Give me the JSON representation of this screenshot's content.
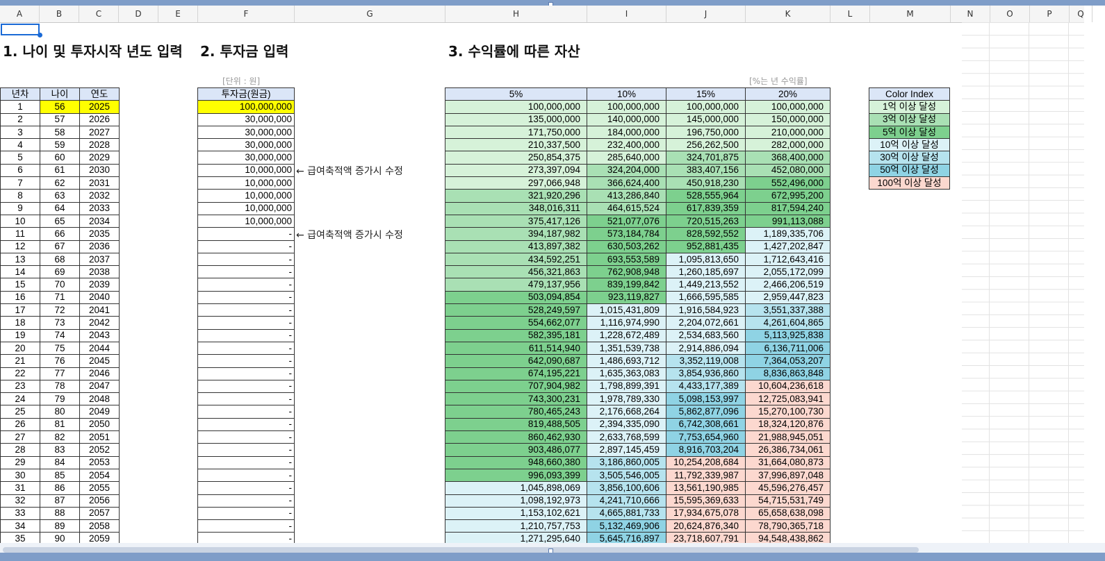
{
  "columns": [
    "A",
    "B",
    "C",
    "D",
    "E",
    "F",
    "G",
    "H",
    "I",
    "J",
    "K",
    "L",
    "M",
    "N",
    "O",
    "P",
    "Q"
  ],
  "titles": {
    "t1": "1. 나이 및 투자시작 년도 입력",
    "t2": "2. 투자금 입력",
    "t3": "3. 수익률에 따른 자산"
  },
  "notes": {
    "unit": "[단위 : 원]",
    "rate": "[%는 년 수익률]"
  },
  "table_a": {
    "headers": [
      "년차",
      "나이",
      "연도"
    ]
  },
  "table_f": {
    "header": "투자금(원금)"
  },
  "table_h": {
    "headers": [
      "5%",
      "10%",
      "15%",
      "20%"
    ]
  },
  "arrows": [
    "← 급여축적액 증가시 수정",
    "← 급여축적액 증가시 수정"
  ],
  "color_index": {
    "header": "Color Index",
    "items": [
      "1억 이상 달성",
      "3억 이상 달성",
      "5억 이상 달성",
      "10억 이상 달성",
      "30억 이상 달성",
      "50억 이상 달성",
      "100억 이상 달성"
    ],
    "colors": [
      "#d6f2d9",
      "#a9e0b4",
      "#7dd08e",
      "#dcf2f7",
      "#b6e3ee",
      "#8fd3e4",
      "#fcd8cf"
    ]
  },
  "rows": [
    {
      "n": "1",
      "age": "56",
      "year": "2025",
      "inv": "100,000,000",
      "v": [
        "100,000,000",
        "100,000,000",
        "100,000,000",
        "100,000,000"
      ]
    },
    {
      "n": "2",
      "age": "57",
      "year": "2026",
      "inv": "30,000,000",
      "v": [
        "135,000,000",
        "140,000,000",
        "145,000,000",
        "150,000,000"
      ]
    },
    {
      "n": "3",
      "age": "58",
      "year": "2027",
      "inv": "30,000,000",
      "v": [
        "171,750,000",
        "184,000,000",
        "196,750,000",
        "210,000,000"
      ]
    },
    {
      "n": "4",
      "age": "59",
      "year": "2028",
      "inv": "30,000,000",
      "v": [
        "210,337,500",
        "232,400,000",
        "256,262,500",
        "282,000,000"
      ]
    },
    {
      "n": "5",
      "age": "60",
      "year": "2029",
      "inv": "30,000,000",
      "v": [
        "250,854,375",
        "285,640,000",
        "324,701,875",
        "368,400,000"
      ]
    },
    {
      "n": "6",
      "age": "61",
      "year": "2030",
      "inv": "10,000,000",
      "v": [
        "273,397,094",
        "324,204,000",
        "383,407,156",
        "452,080,000"
      ]
    },
    {
      "n": "7",
      "age": "62",
      "year": "2031",
      "inv": "10,000,000",
      "v": [
        "297,066,948",
        "366,624,400",
        "450,918,230",
        "552,496,000"
      ]
    },
    {
      "n": "8",
      "age": "63",
      "year": "2032",
      "inv": "10,000,000",
      "v": [
        "321,920,296",
        "413,286,840",
        "528,555,964",
        "672,995,200"
      ]
    },
    {
      "n": "9",
      "age": "64",
      "year": "2033",
      "inv": "10,000,000",
      "v": [
        "348,016,311",
        "464,615,524",
        "617,839,359",
        "817,594,240"
      ]
    },
    {
      "n": "10",
      "age": "65",
      "year": "2034",
      "inv": "10,000,000",
      "v": [
        "375,417,126",
        "521,077,076",
        "720,515,263",
        "991,113,088"
      ]
    },
    {
      "n": "11",
      "age": "66",
      "year": "2035",
      "inv": "-",
      "v": [
        "394,187,982",
        "573,184,784",
        "828,592,552",
        "1,189,335,706"
      ]
    },
    {
      "n": "12",
      "age": "67",
      "year": "2036",
      "inv": "-",
      "v": [
        "413,897,382",
        "630,503,262",
        "952,881,435",
        "1,427,202,847"
      ]
    },
    {
      "n": "13",
      "age": "68",
      "year": "2037",
      "inv": "-",
      "v": [
        "434,592,251",
        "693,553,589",
        "1,095,813,650",
        "1,712,643,416"
      ]
    },
    {
      "n": "14",
      "age": "69",
      "year": "2038",
      "inv": "-",
      "v": [
        "456,321,863",
        "762,908,948",
        "1,260,185,697",
        "2,055,172,099"
      ]
    },
    {
      "n": "15",
      "age": "70",
      "year": "2039",
      "inv": "-",
      "v": [
        "479,137,956",
        "839,199,842",
        "1,449,213,552",
        "2,466,206,519"
      ]
    },
    {
      "n": "16",
      "age": "71",
      "year": "2040",
      "inv": "-",
      "v": [
        "503,094,854",
        "923,119,827",
        "1,666,595,585",
        "2,959,447,823"
      ]
    },
    {
      "n": "17",
      "age": "72",
      "year": "2041",
      "inv": "-",
      "v": [
        "528,249,597",
        "1,015,431,809",
        "1,916,584,923",
        "3,551,337,388"
      ]
    },
    {
      "n": "18",
      "age": "73",
      "year": "2042",
      "inv": "-",
      "v": [
        "554,662,077",
        "1,116,974,990",
        "2,204,072,661",
        "4,261,604,865"
      ]
    },
    {
      "n": "19",
      "age": "74",
      "year": "2043",
      "inv": "-",
      "v": [
        "582,395,181",
        "1,228,672,489",
        "2,534,683,560",
        "5,113,925,838"
      ]
    },
    {
      "n": "20",
      "age": "75",
      "year": "2044",
      "inv": "-",
      "v": [
        "611,514,940",
        "1,351,539,738",
        "2,914,886,094",
        "6,136,711,006"
      ]
    },
    {
      "n": "21",
      "age": "76",
      "year": "2045",
      "inv": "-",
      "v": [
        "642,090,687",
        "1,486,693,712",
        "3,352,119,008",
        "7,364,053,207"
      ]
    },
    {
      "n": "22",
      "age": "77",
      "year": "2046",
      "inv": "-",
      "v": [
        "674,195,221",
        "1,635,363,083",
        "3,854,936,860",
        "8,836,863,848"
      ]
    },
    {
      "n": "23",
      "age": "78",
      "year": "2047",
      "inv": "-",
      "v": [
        "707,904,982",
        "1,798,899,391",
        "4,433,177,389",
        "10,604,236,618"
      ]
    },
    {
      "n": "24",
      "age": "79",
      "year": "2048",
      "inv": "-",
      "v": [
        "743,300,231",
        "1,978,789,330",
        "5,098,153,997",
        "12,725,083,941"
      ]
    },
    {
      "n": "25",
      "age": "80",
      "year": "2049",
      "inv": "-",
      "v": [
        "780,465,243",
        "2,176,668,264",
        "5,862,877,096",
        "15,270,100,730"
      ]
    },
    {
      "n": "26",
      "age": "81",
      "year": "2050",
      "inv": "-",
      "v": [
        "819,488,505",
        "2,394,335,090",
        "6,742,308,661",
        "18,324,120,876"
      ]
    },
    {
      "n": "27",
      "age": "82",
      "year": "2051",
      "inv": "-",
      "v": [
        "860,462,930",
        "2,633,768,599",
        "7,753,654,960",
        "21,988,945,051"
      ]
    },
    {
      "n": "28",
      "age": "83",
      "year": "2052",
      "inv": "-",
      "v": [
        "903,486,077",
        "2,897,145,459",
        "8,916,703,204",
        "26,386,734,061"
      ]
    },
    {
      "n": "29",
      "age": "84",
      "year": "2053",
      "inv": "-",
      "v": [
        "948,660,380",
        "3,186,860,005",
        "10,254,208,684",
        "31,664,080,873"
      ]
    },
    {
      "n": "30",
      "age": "85",
      "year": "2054",
      "inv": "-",
      "v": [
        "996,093,399",
        "3,505,546,005",
        "11,792,339,987",
        "37,996,897,048"
      ]
    },
    {
      "n": "31",
      "age": "86",
      "year": "2055",
      "inv": "-",
      "v": [
        "1,045,898,069",
        "3,856,100,606",
        "13,561,190,985",
        "45,596,276,457"
      ]
    },
    {
      "n": "32",
      "age": "87",
      "year": "2056",
      "inv": "-",
      "v": [
        "1,098,192,973",
        "4,241,710,666",
        "15,595,369,633",
        "54,715,531,749"
      ]
    },
    {
      "n": "33",
      "age": "88",
      "year": "2057",
      "inv": "-",
      "v": [
        "1,153,102,621",
        "4,665,881,733",
        "17,934,675,078",
        "65,658,638,098"
      ]
    },
    {
      "n": "34",
      "age": "89",
      "year": "2058",
      "inv": "-",
      "v": [
        "1,210,757,753",
        "5,132,469,906",
        "20,624,876,340",
        "78,790,365,718"
      ]
    },
    {
      "n": "35",
      "age": "90",
      "year": "2059",
      "inv": "-",
      "v": [
        "1,271,295,640",
        "5,645,716,897",
        "23,718,607,791",
        "94,548,438,862"
      ]
    }
  ],
  "h_colors": [
    [
      "#d6f2d9",
      "#d6f2d9",
      "#d6f2d9",
      "#d6f2d9"
    ],
    [
      "#d6f2d9",
      "#d6f2d9",
      "#d6f2d9",
      "#d6f2d9"
    ],
    [
      "#d6f2d9",
      "#d6f2d9",
      "#d6f2d9",
      "#d6f2d9"
    ],
    [
      "#d6f2d9",
      "#d6f2d9",
      "#d6f2d9",
      "#d6f2d9"
    ],
    [
      "#d6f2d9",
      "#d6f2d9",
      "#a9e0b4",
      "#a9e0b4"
    ],
    [
      "#d6f2d9",
      "#a9e0b4",
      "#a9e0b4",
      "#a9e0b4"
    ],
    [
      "#d6f2d9",
      "#a9e0b4",
      "#a9e0b4",
      "#7dd08e"
    ],
    [
      "#a9e0b4",
      "#a9e0b4",
      "#7dd08e",
      "#7dd08e"
    ],
    [
      "#a9e0b4",
      "#a9e0b4",
      "#7dd08e",
      "#7dd08e"
    ],
    [
      "#a9e0b4",
      "#7dd08e",
      "#7dd08e",
      "#7dd08e"
    ],
    [
      "#a9e0b4",
      "#7dd08e",
      "#7dd08e",
      "#dcf2f7"
    ],
    [
      "#a9e0b4",
      "#7dd08e",
      "#7dd08e",
      "#dcf2f7"
    ],
    [
      "#a9e0b4",
      "#7dd08e",
      "#dcf2f7",
      "#dcf2f7"
    ],
    [
      "#a9e0b4",
      "#7dd08e",
      "#dcf2f7",
      "#dcf2f7"
    ],
    [
      "#a9e0b4",
      "#7dd08e",
      "#dcf2f7",
      "#dcf2f7"
    ],
    [
      "#7dd08e",
      "#7dd08e",
      "#dcf2f7",
      "#dcf2f7"
    ],
    [
      "#7dd08e",
      "#dcf2f7",
      "#dcf2f7",
      "#b6e3ee"
    ],
    [
      "#7dd08e",
      "#dcf2f7",
      "#dcf2f7",
      "#b6e3ee"
    ],
    [
      "#7dd08e",
      "#dcf2f7",
      "#dcf2f7",
      "#8fd3e4"
    ],
    [
      "#7dd08e",
      "#dcf2f7",
      "#dcf2f7",
      "#8fd3e4"
    ],
    [
      "#7dd08e",
      "#dcf2f7",
      "#b6e3ee",
      "#8fd3e4"
    ],
    [
      "#7dd08e",
      "#dcf2f7",
      "#b6e3ee",
      "#8fd3e4"
    ],
    [
      "#7dd08e",
      "#dcf2f7",
      "#b6e3ee",
      "#fcd8cf"
    ],
    [
      "#7dd08e",
      "#dcf2f7",
      "#8fd3e4",
      "#fcd8cf"
    ],
    [
      "#7dd08e",
      "#dcf2f7",
      "#8fd3e4",
      "#fcd8cf"
    ],
    [
      "#7dd08e",
      "#dcf2f7",
      "#8fd3e4",
      "#fcd8cf"
    ],
    [
      "#7dd08e",
      "#dcf2f7",
      "#8fd3e4",
      "#fcd8cf"
    ],
    [
      "#7dd08e",
      "#dcf2f7",
      "#8fd3e4",
      "#fcd8cf"
    ],
    [
      "#7dd08e",
      "#b6e3ee",
      "#fcd8cf",
      "#fcd8cf"
    ],
    [
      "#7dd08e",
      "#b6e3ee",
      "#fcd8cf",
      "#fcd8cf"
    ],
    [
      "#dcf2f7",
      "#b6e3ee",
      "#fcd8cf",
      "#fcd8cf"
    ],
    [
      "#dcf2f7",
      "#b6e3ee",
      "#fcd8cf",
      "#fcd8cf"
    ],
    [
      "#dcf2f7",
      "#b6e3ee",
      "#fcd8cf",
      "#fcd8cf"
    ],
    [
      "#dcf2f7",
      "#8fd3e4",
      "#fcd8cf",
      "#fcd8cf"
    ],
    [
      "#dcf2f7",
      "#8fd3e4",
      "#fcd8cf",
      "#fcd8cf"
    ]
  ]
}
